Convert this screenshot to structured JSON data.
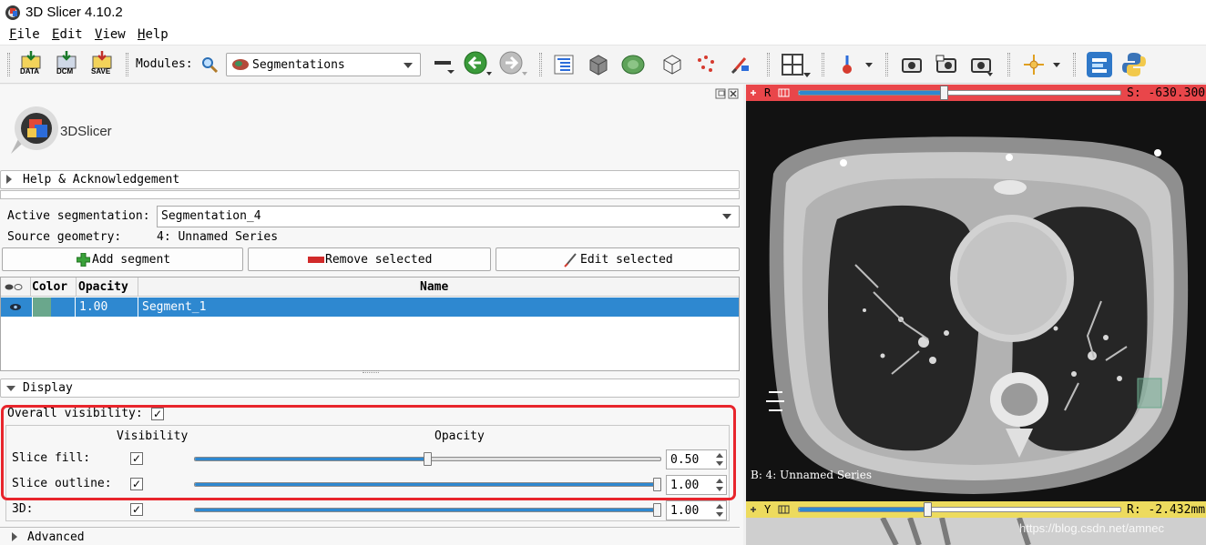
{
  "window": {
    "title": "3D Slicer 4.10.2"
  },
  "menu": {
    "file": "ile",
    "file_key": "F",
    "edit": "dit",
    "edit_key": "E",
    "view": "iew",
    "view_key": "V",
    "help": "elp",
    "help_key": "H"
  },
  "toolbar": {
    "data_label": "DATA",
    "dcm_label": "DCM",
    "save_label": "SAVE",
    "modules_label": "Modules:",
    "module_selected": "Segmentations"
  },
  "module": {
    "logo_text": "3DSlicer"
  },
  "sections": {
    "help": "Help & Acknowledgement",
    "display": "Display",
    "advanced": "Advanced"
  },
  "segmentation": {
    "active_label": "Active segmentation:",
    "active_value": "Segmentation_4",
    "source_label": "Source geometry:",
    "source_value": "4: Unnamed Series"
  },
  "buttons": {
    "add": "Add segment",
    "remove": "Remove selected",
    "edit": "Edit selected"
  },
  "table": {
    "headers": {
      "color": "Color",
      "opacity": "Opacity",
      "name": "Name"
    },
    "rows": [
      {
        "color": "#6aa78c",
        "opacity": "1.00",
        "name": "Segment_1"
      }
    ]
  },
  "display": {
    "overall_visibility_label": "Overall visibility:",
    "overall_visibility": true,
    "visibility_header": "Visibility",
    "opacity_header": "Opacity",
    "rows": [
      {
        "label": "Slice fill:",
        "visible": true,
        "opacity": 0.5,
        "value": "0.50"
      },
      {
        "label": "Slice outline:",
        "visible": true,
        "opacity": 1.0,
        "value": "1.00"
      },
      {
        "label": "3D:",
        "visible": true,
        "opacity": 1.0,
        "value": "1.00"
      }
    ]
  },
  "viewer": {
    "red": {
      "letter": "R",
      "readout": "S: -630.300",
      "slider_value": 0.45
    },
    "yellow": {
      "letter": "Y",
      "readout": "R: -2.432mm",
      "slider_value": 0.4
    },
    "corner_text": "B: 4: Unnamed Series",
    "watermark": "https://blog.csdn.net/amnec"
  },
  "colors": {
    "accent": "#2e88d0",
    "highlight": "#e8252c",
    "red_slice": "#e9464a",
    "yellow_slice": "#eddb5e",
    "segment": "#6aa78c"
  }
}
